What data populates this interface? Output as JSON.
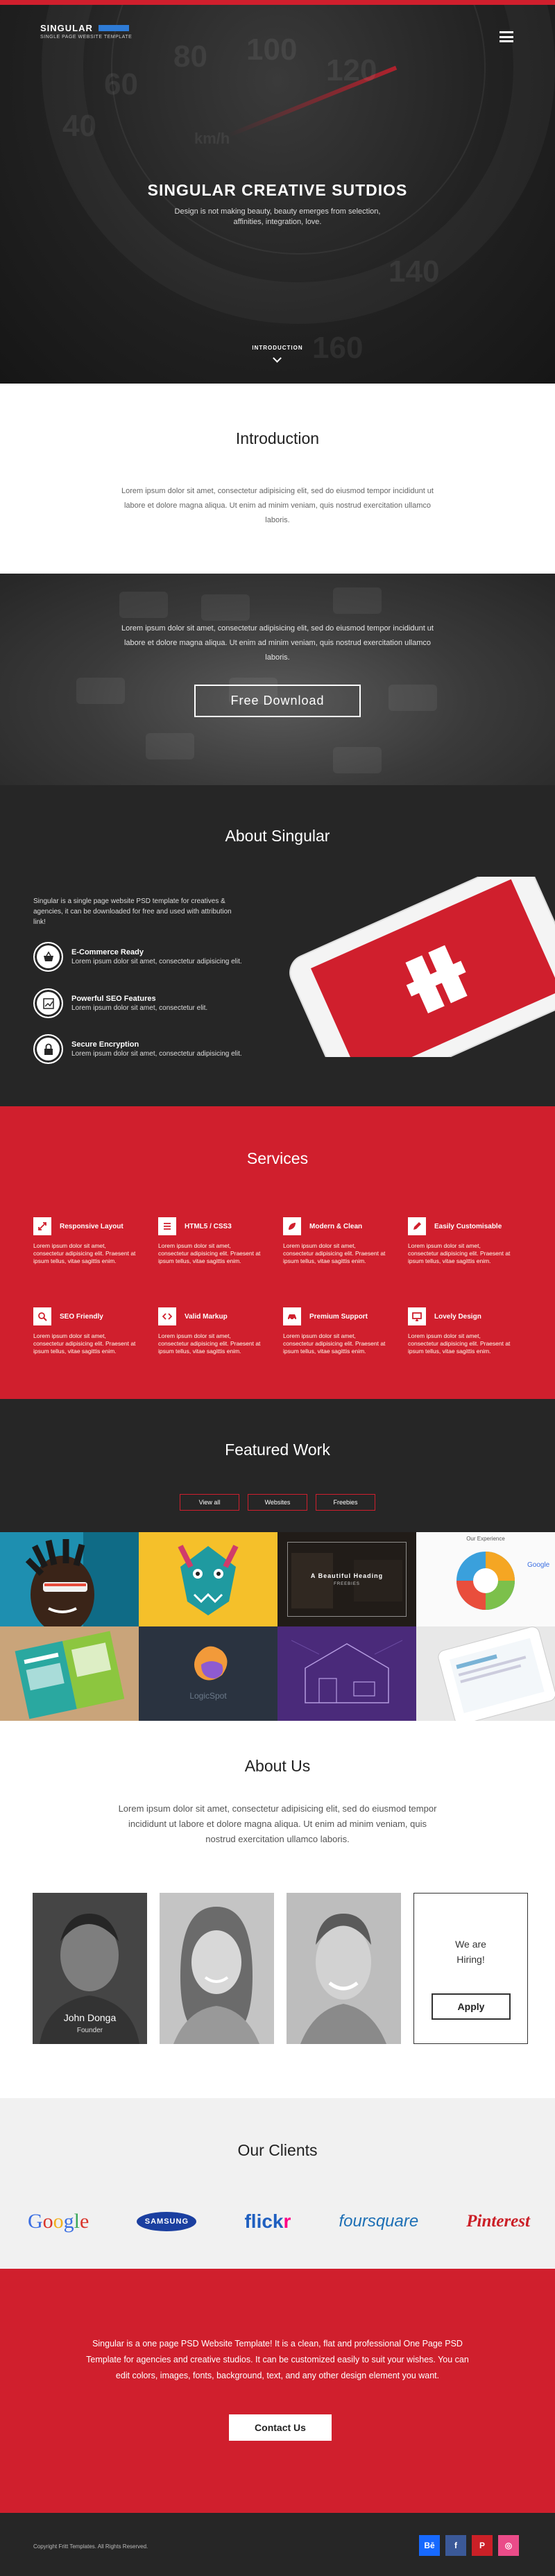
{
  "brand": {
    "name": "SINGULAR",
    "tagline": "SINGLE PAGE WEBSITE TEMPLATE",
    "accent": "#d01f2d"
  },
  "hero": {
    "title": "SINGULAR CREATIVE SUTDIOS",
    "subtitle": "Design is not making beauty, beauty emerges from selection, affinities, integration, love.",
    "scroll_label": "INTRODUCTION",
    "gauge_numbers": [
      "40",
      "60",
      "80",
      "100",
      "120",
      "140",
      "160"
    ],
    "gauge_unit": "km/h"
  },
  "intro": {
    "title": "Introduction",
    "text": "Lorem ipsum dolor sit amet, consectetur adipisicing elit, sed do eiusmod tempor incididunt ut labore et dolore magna aliqua. Ut enim ad minim veniam, quis nostrud exercitation ullamco laboris."
  },
  "download": {
    "text": "Lorem ipsum dolor sit amet, consectetur adipisicing elit, sed do eiusmod tempor incididunt ut labore et dolore magna aliqua. Ut enim ad minim veniam, quis nostrud exercitation ullamco laboris.",
    "button": "Free Download"
  },
  "about_singular": {
    "title": "About Singular",
    "lead": "Singular is a single page website PSD template for creatives & agencies, it can be downloaded for free and used with attribution link!",
    "features": [
      {
        "title": "E-Commerce Ready",
        "desc": "Lorem ipsum dolor sit amet, consectetur adipisicing elit.",
        "icon": "basket-icon"
      },
      {
        "title": "Powerful SEO Features",
        "desc": "Lorem ipsum dolor sit amet, consectetur elit.",
        "icon": "chart-icon"
      },
      {
        "title": "Secure Encryption",
        "desc": "Lorem ipsum dolor sit amet, consectetur adipisicing elit.",
        "icon": "lock-icon"
      }
    ]
  },
  "services": {
    "title": "Services",
    "items": [
      {
        "title": "Responsive Layout",
        "desc": "Lorem ipsum dolor sit amet, consectetur adipisicing elit. Praesent at ipsum tellus, vitae sagittis enim.",
        "icon": "resize-icon"
      },
      {
        "title": "HTML5 / CSS3",
        "desc": "Lorem ipsum dolor sit amet, consectetur adipisicing elit. Praesent at ipsum tellus, vitae sagittis enim.",
        "icon": "list-icon"
      },
      {
        "title": "Modern & Clean",
        "desc": "Lorem ipsum dolor sit amet, consectetur adipisicing elit. Praesent at ipsum tellus, vitae sagittis enim.",
        "icon": "leaf-icon"
      },
      {
        "title": "Easily Customisable",
        "desc": "Lorem ipsum dolor sit amet, consectetur adipisicing elit. Praesent at ipsum tellus, vitae sagittis enim.",
        "icon": "pencil-icon"
      },
      {
        "title": "SEO Friendly",
        "desc": "Lorem ipsum dolor sit amet, consectetur adipisicing elit. Praesent at ipsum tellus, vitae sagittis enim.",
        "icon": "search-icon"
      },
      {
        "title": "Valid Markup",
        "desc": "Lorem ipsum dolor sit amet, consectetur adipisicing elit. Praesent at ipsum tellus, vitae sagittis enim.",
        "icon": "code-icon"
      },
      {
        "title": "Premium Support",
        "desc": "Lorem ipsum dolor sit amet, consectetur adipisicing elit. Praesent at ipsum tellus, vitae sagittis enim.",
        "icon": "car-icon"
      },
      {
        "title": "Lovely Design",
        "desc": "Lorem ipsum dolor sit amet, consectetur adipisicing elit. Praesent at ipsum tellus, vitae sagittis enim.",
        "icon": "monitor-icon"
      }
    ]
  },
  "work": {
    "title": "Featured Work",
    "filters": [
      "View all",
      "Websites",
      "Freebies"
    ],
    "overlay": {
      "title": "A Beautiful Heading",
      "category": "FREEBIES"
    },
    "experience_label": "Our Experience",
    "google_label": "Google",
    "logicspot_label": "LogicSpot"
  },
  "about_us": {
    "title": "About Us",
    "text": "Lorem ipsum dolor sit amet, consectetur adipisicing elit, sed do eiusmod tempor incididunt ut labore et dolore magna aliqua. Ut enim ad minim veniam, quis nostrud exercitation ullamco laboris.",
    "member": {
      "name": "John Donga",
      "role": "Founder"
    },
    "hiring": {
      "line1": "We are",
      "line2": "Hiring!",
      "button": "Apply"
    }
  },
  "clients": {
    "title": "Our Clients",
    "logos": {
      "google": "Google",
      "samsung": "SAMSUNG",
      "flickr_a": "flick",
      "flickr_b": "r",
      "foursquare": "foursquare",
      "pinterest": "Pinterest"
    }
  },
  "cta": {
    "text": "Singular is a one page PSD Website Template! It is a clean, flat and professional One Page PSD Template for agencies and creative studios. It can be customized easily to suit your wishes. You can edit colors, images, fonts, background, text, and any other design element you want.",
    "button": "Contact Us"
  },
  "footer": {
    "copyright": "Copyright Fritt Templates. All Rights Reserved.",
    "social": [
      {
        "label": "Bē",
        "icon": "behance-icon",
        "color": "#1769ff"
      },
      {
        "label": "f",
        "icon": "facebook-icon",
        "color": "#3b5998"
      },
      {
        "label": "P",
        "icon": "pinterest-icon",
        "color": "#cb2027"
      },
      {
        "label": "◎",
        "icon": "dribbble-icon",
        "color": "#ea4c89"
      }
    ]
  }
}
